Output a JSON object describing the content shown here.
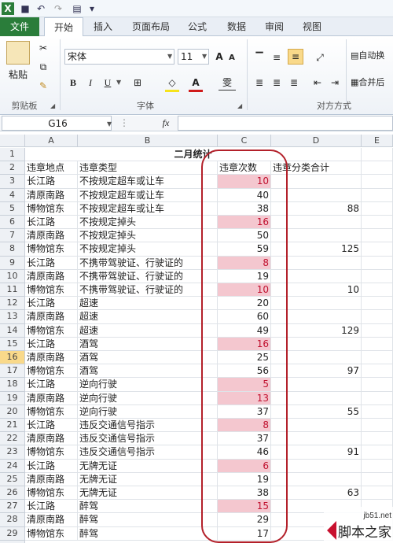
{
  "quick_access": {
    "save_glyph": "■",
    "undo_glyph": "↶",
    "redo_glyph": "↷",
    "preview_glyph": "▤"
  },
  "tabs": [
    "文件",
    "开始",
    "插入",
    "页面布局",
    "公式",
    "数据",
    "审阅",
    "视图"
  ],
  "ribbon": {
    "paste_label": "粘贴",
    "clipboard_label": "剪贴板",
    "font_name": "宋体",
    "font_size": "11",
    "grow_label": "A",
    "shrink_label": "A",
    "bold": "B",
    "italic": "I",
    "underline": "U",
    "font_color_label": "A",
    "phonetic_label": "雯",
    "font_group_label": "字体",
    "wrap_label": "自动换",
    "merge_label": "合并后",
    "align_group_label": "对方方式"
  },
  "formula_bar": {
    "name_box": "G16",
    "fx": "fx",
    "formula": ""
  },
  "columns": [
    "A",
    "B",
    "C",
    "D",
    "E"
  ],
  "sheet": {
    "title": "二月统计",
    "headers": [
      "违章地点",
      "违章类型",
      "违章次数",
      "违章分类合计"
    ],
    "rows": [
      [
        "长江路",
        "不按规定超车或让车",
        "10",
        ""
      ],
      [
        "清原南路",
        "不按规定超车或让车",
        "40",
        ""
      ],
      [
        "博物馆东",
        "不按规定超车或让车",
        "38",
        "88"
      ],
      [
        "长江路",
        "不按规定掉头",
        "16",
        ""
      ],
      [
        "清原南路",
        "不按规定掉头",
        "50",
        ""
      ],
      [
        "博物馆东",
        "不按规定掉头",
        "59",
        "125"
      ],
      [
        "长江路",
        "不携带驾驶证、行驶证的",
        "8",
        ""
      ],
      [
        "清原南路",
        "不携带驾驶证、行驶证的",
        "19",
        ""
      ],
      [
        "博物馆东",
        "不携带驾驶证、行驶证的",
        "10",
        "10"
      ],
      [
        "长江路",
        "超速",
        "20",
        ""
      ],
      [
        "清原南路",
        "超速",
        "60",
        ""
      ],
      [
        "博物馆东",
        "超速",
        "49",
        "129"
      ],
      [
        "长江路",
        "酒驾",
        "16",
        ""
      ],
      [
        "清原南路",
        "酒驾",
        "25",
        ""
      ],
      [
        "博物馆东",
        "酒驾",
        "56",
        "97"
      ],
      [
        "长江路",
        "逆向行驶",
        "5",
        ""
      ],
      [
        "清原南路",
        "逆向行驶",
        "13",
        ""
      ],
      [
        "博物馆东",
        "逆向行驶",
        "37",
        "55"
      ],
      [
        "长江路",
        "违反交通信号指示",
        "8",
        ""
      ],
      [
        "清原南路",
        "违反交通信号指示",
        "37",
        ""
      ],
      [
        "博物馆东",
        "违反交通信号指示",
        "46",
        "91"
      ],
      [
        "长江路",
        "无牌无证",
        "6",
        ""
      ],
      [
        "清原南路",
        "无牌无证",
        "19",
        ""
      ],
      [
        "博物馆东",
        "无牌无证",
        "38",
        "63"
      ],
      [
        "长江路",
        "醉驾",
        "15",
        ""
      ],
      [
        "清原南路",
        "醉驾",
        "29",
        ""
      ],
      [
        "博物馆东",
        "醉驾",
        "17",
        ""
      ]
    ],
    "highlighted_rows": [
      0,
      3,
      6,
      8,
      12,
      15,
      16,
      18,
      21,
      24
    ],
    "selected_row_number": 16,
    "last_row_number": "30"
  },
  "watermark": {
    "line1": "jb51.net",
    "line2": "脚本之家"
  },
  "colors": {
    "file_tab": "#2a7d3a",
    "highlight_fill": "#f4c7cf",
    "highlight_text": "#c0102e",
    "oval": "#b3202a"
  }
}
